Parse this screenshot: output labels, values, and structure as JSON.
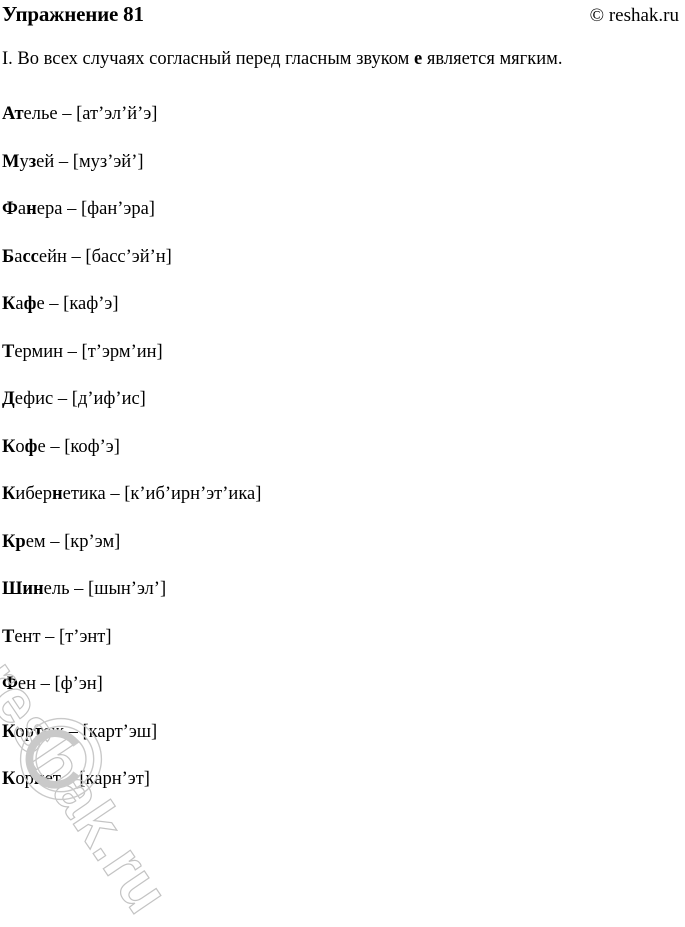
{
  "header": {
    "title": "Упражнение 81",
    "copyright": "© reshak.ru"
  },
  "intro": {
    "prefix": "I. Во всех случаях согласный перед гласным звуком ",
    "emphasis": "е",
    "suffix": " является мягким."
  },
  "watermark": {
    "text": "reshak.ru",
    "symbol": "©",
    "color": "#b9b9b9"
  },
  "words": [
    {
      "bold1": "А",
      "mid": "",
      "bold2": "т",
      "rest": "елье",
      "dash": "–",
      "transcription": "[ат’эл’й’э]"
    },
    {
      "bold1": "М",
      "mid": "у",
      "bold2": "з",
      "rest": "ей",
      "dash": "–",
      "transcription": "[муз’эй’]"
    },
    {
      "bold1": "Ф",
      "mid": "а",
      "bold2": "н",
      "rest": "ера",
      "dash": "–",
      "transcription": "[фан’эра]"
    },
    {
      "bold1": "Б",
      "mid": "а",
      "bold2": "сс",
      "rest": "ейн",
      "dash": "–",
      "transcription": "[басс’эй’н]"
    },
    {
      "bold1": "К",
      "mid": "а",
      "bold2": "ф",
      "rest": "е",
      "dash": "–",
      "transcription": "[каф’э]"
    },
    {
      "bold1": "Т",
      "mid": "",
      "bold2": "",
      "rest": "ермин",
      "dash": "–",
      "transcription": "[т’эрм’ин]"
    },
    {
      "bold1": "Д",
      "mid": "",
      "bold2": "",
      "rest": "ефис",
      "dash": "–",
      "transcription": "[д’иф’ис]"
    },
    {
      "bold1": "К",
      "mid": "о",
      "bold2": "ф",
      "rest": "е",
      "dash": "–",
      "transcription": "[коф’э]"
    },
    {
      "bold1": "К",
      "mid": "ибер",
      "bold2": "н",
      "rest": "етика",
      "dash": "–",
      "transcription": "[к’иб’ирн’эт’ика]"
    },
    {
      "bold1": "К",
      "mid": "",
      "bold2": "р",
      "rest": "ем",
      "dash": "–",
      "transcription": "[кр’эм]"
    },
    {
      "bold1": "Ш",
      "mid": "",
      "bold2": "ин",
      "rest": "ель",
      "dash": "–",
      "transcription": "[шын’эл’]"
    },
    {
      "bold1": "Т",
      "mid": "",
      "bold2": "",
      "rest": "ент",
      "dash": "–",
      "transcription": "[т’энт]"
    },
    {
      "bold1": "Ф",
      "mid": "",
      "bold2": "",
      "rest": "ен",
      "dash": "–",
      "transcription": "[ф’эн]"
    },
    {
      "bold1": "К",
      "mid": "ор",
      "bold2": "т",
      "rest": "еж",
      "dash": "–",
      "transcription": "[карт’эш]"
    },
    {
      "bold1": "К",
      "mid": "ор",
      "bold2": "н",
      "rest": "ет",
      "dash": "–",
      "transcription": "[карн’эт]"
    }
  ]
}
